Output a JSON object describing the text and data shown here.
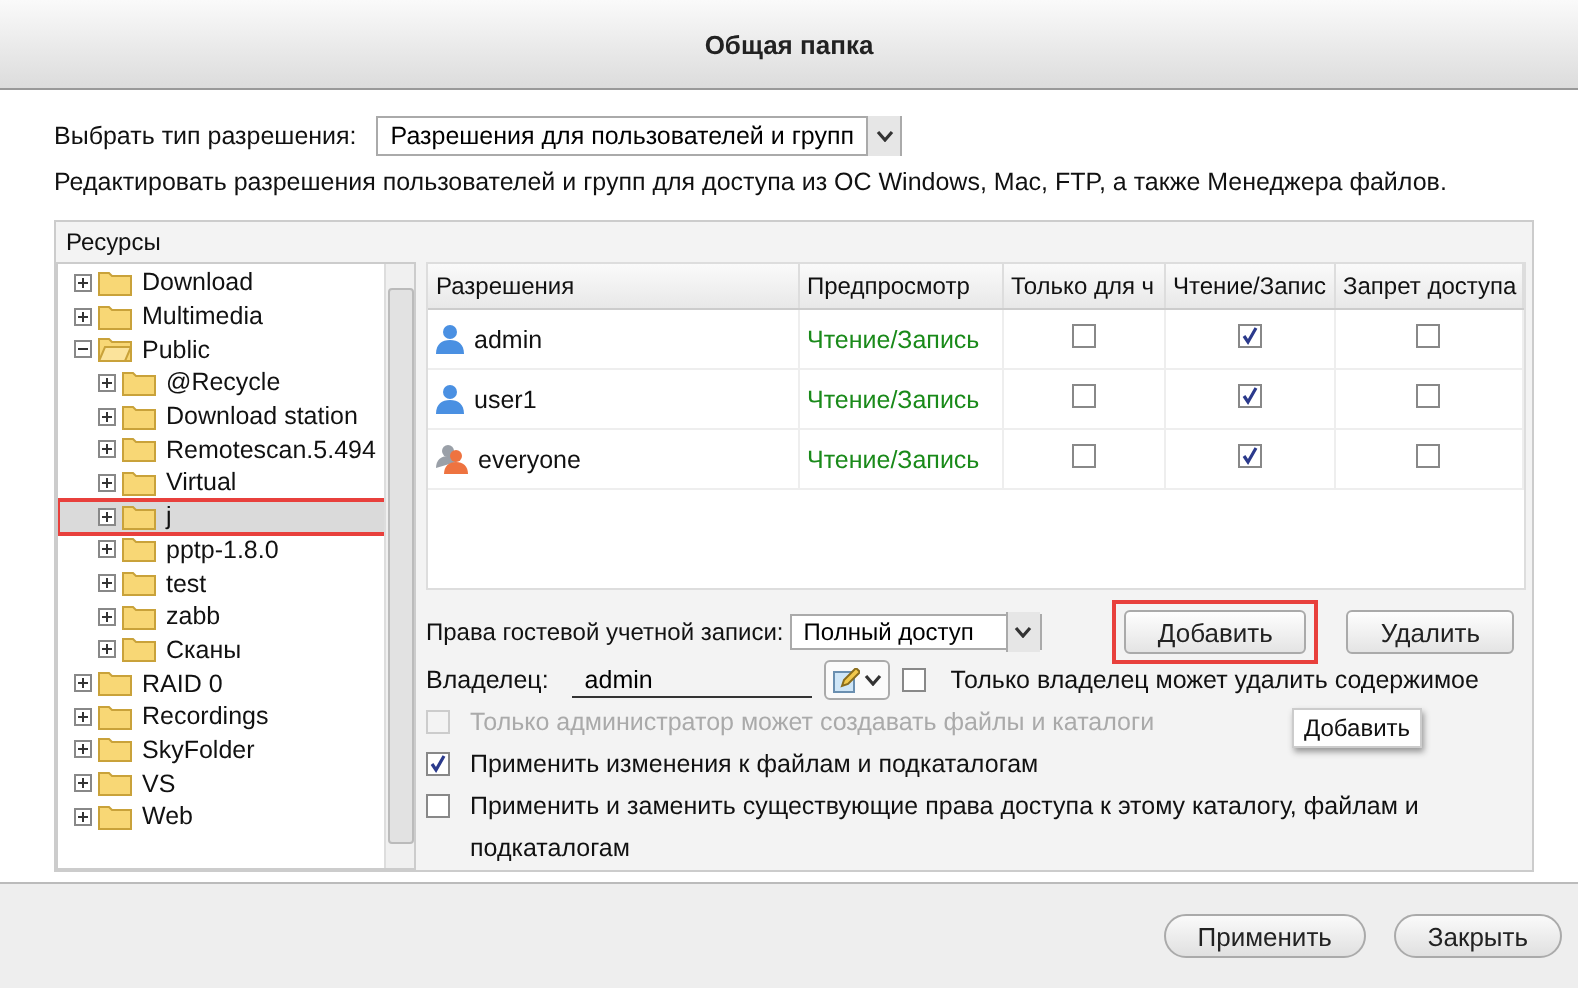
{
  "window": {
    "title": "Общая папка"
  },
  "permission_type": {
    "label": "Выбрать тип разрешения:",
    "value": "Разрешения для пользователей и групп"
  },
  "description": "Редактировать разрешения пользователей и групп для доступа из ОС Windows, Mac, FTP, а также Менеджера файлов.",
  "resources": {
    "title": "Ресурсы",
    "tree": [
      {
        "label": "Download",
        "expanded": false,
        "selected": false,
        "annotated": false
      },
      {
        "label": "Multimedia",
        "expanded": false,
        "selected": false,
        "annotated": false
      },
      {
        "label": "Public",
        "expanded": true,
        "selected": false,
        "annotated": false,
        "children": [
          {
            "label": "@Recycle",
            "expanded": false,
            "selected": false,
            "annotated": false
          },
          {
            "label": "Download station",
            "expanded": false,
            "selected": false,
            "annotated": false
          },
          {
            "label": "Remotescan.5.494",
            "expanded": false,
            "selected": false,
            "annotated": false
          },
          {
            "label": "Virtual",
            "expanded": false,
            "selected": false,
            "annotated": false
          },
          {
            "label": "j",
            "expanded": false,
            "selected": true,
            "annotated": true
          },
          {
            "label": "pptp-1.8.0",
            "expanded": false,
            "selected": false,
            "annotated": false
          },
          {
            "label": "test",
            "expanded": false,
            "selected": false,
            "annotated": false
          },
          {
            "label": "zabb",
            "expanded": false,
            "selected": false,
            "annotated": false
          },
          {
            "label": "Сканы",
            "expanded": false,
            "selected": false,
            "annotated": false
          }
        ]
      },
      {
        "label": "RAID 0",
        "expanded": false,
        "selected": false,
        "annotated": false
      },
      {
        "label": "Recordings",
        "expanded": false,
        "selected": false,
        "annotated": false
      },
      {
        "label": "SkyFolder",
        "expanded": false,
        "selected": false,
        "annotated": false
      },
      {
        "label": "VS",
        "expanded": false,
        "selected": false,
        "annotated": false
      },
      {
        "label": "Web",
        "expanded": false,
        "selected": false,
        "annotated": false
      }
    ]
  },
  "table": {
    "columns": [
      "Разрешения",
      "Предпросмотр",
      "Только для ч",
      "Чтение/Запис",
      "Запрет доступа"
    ],
    "rows": [
      {
        "kind": "user",
        "name": "admin",
        "preview": "Чтение/Запись",
        "read_only": false,
        "read_write": true,
        "deny": false
      },
      {
        "kind": "user",
        "name": "user1",
        "preview": "Чтение/Запись",
        "read_only": false,
        "read_write": true,
        "deny": false
      },
      {
        "kind": "group",
        "name": "everyone",
        "preview": "Чтение/Запись",
        "read_only": false,
        "read_write": true,
        "deny": false
      }
    ]
  },
  "guest": {
    "label": "Права гостевой учетной записи:",
    "value": "Полный доступ"
  },
  "buttons": [
    {
      "label": "Добавить",
      "annotated": true
    },
    {
      "label": "Удалить",
      "annotated": false
    }
  ],
  "tooltip": "Добавить",
  "owner": {
    "label": "Владелец:",
    "value": "admin",
    "only_owner_delete": {
      "label": "Только владелец может удалить содержимое",
      "checked": false
    }
  },
  "options": [
    {
      "label": "Только администратор может создавать файлы и каталоги",
      "checked": false,
      "disabled": true
    },
    {
      "label": "Применить изменения к файлам и подкаталогам",
      "checked": true,
      "disabled": false
    },
    {
      "label": "Применить и заменить существующие права доступа к этому каталогу, файлам и подкаталогам",
      "checked": false,
      "disabled": false
    }
  ],
  "footer_buttons": [
    "Применить",
    "Закрыть"
  ]
}
